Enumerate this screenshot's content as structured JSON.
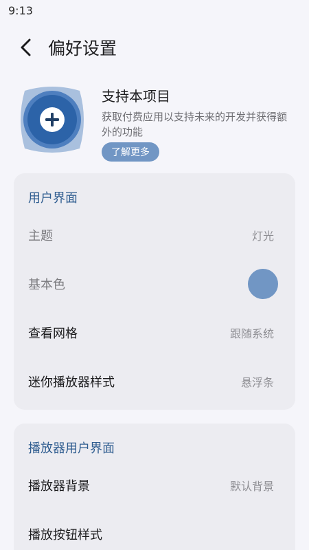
{
  "status_bar": {
    "time": "9:13"
  },
  "app_bar": {
    "title": "偏好设置"
  },
  "promo": {
    "title": "支持本项目",
    "description": "获取付费应用以支持未来的开发并获得额外的功能",
    "button_label": "了解更多",
    "icon": "plus-icon"
  },
  "sections": [
    {
      "header": "用户界面",
      "rows": [
        {
          "label": "主题",
          "value": "灯光"
        },
        {
          "label": "基本色",
          "value": ""
        },
        {
          "label": "查看网格",
          "value": "跟随系统"
        },
        {
          "label": "迷你播放器样式",
          "value": "悬浮条"
        }
      ]
    },
    {
      "header": "播放器用户界面",
      "rows": [
        {
          "label": "播放器背景",
          "value": "默认背景"
        },
        {
          "label": "播放按钮样式",
          "value": ""
        }
      ]
    }
  ],
  "colors": {
    "accent": "#7196c4",
    "section_header": "#2f5d90",
    "card_bg": "#ececf1",
    "page_bg": "#f5f5fa"
  }
}
